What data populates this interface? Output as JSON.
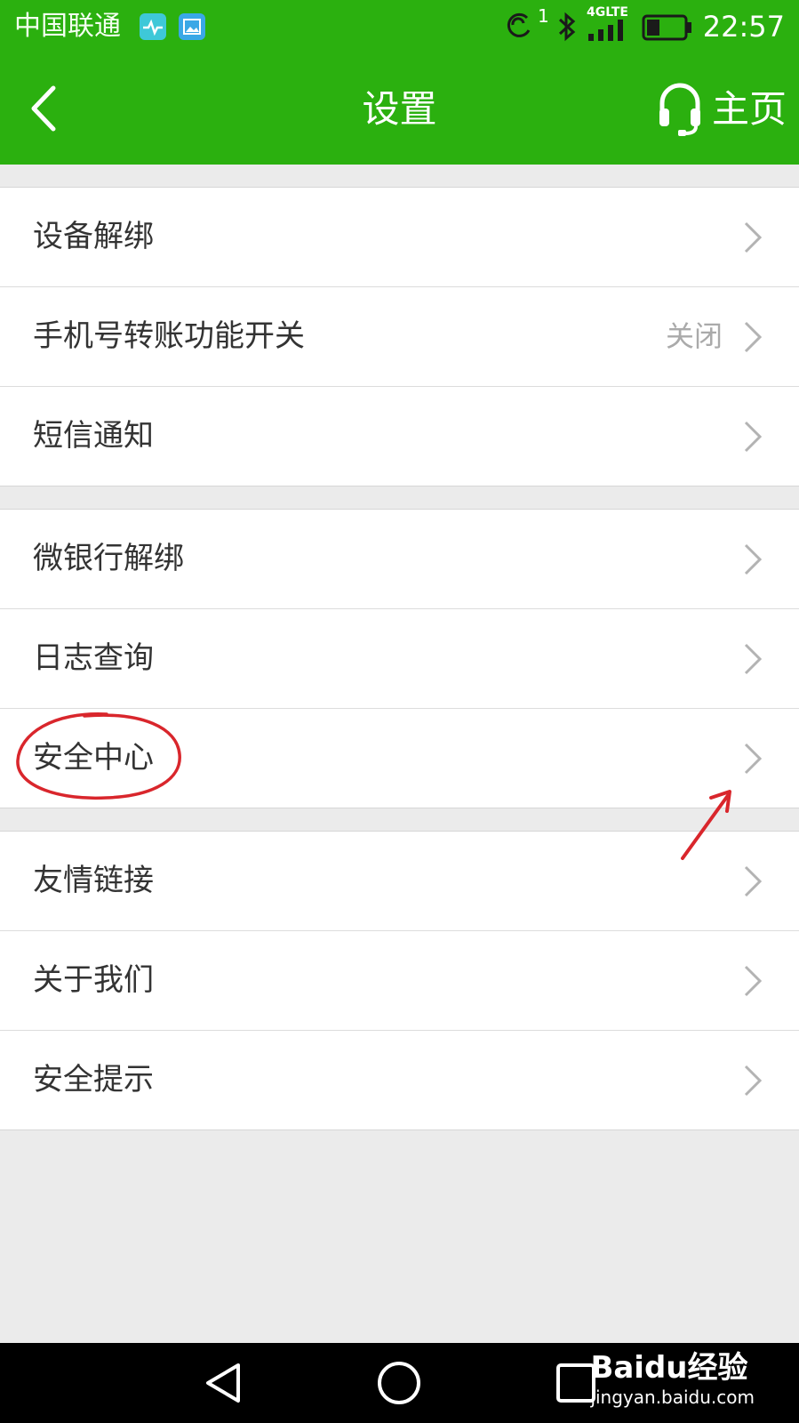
{
  "status_bar": {
    "carrier": "中国联通",
    "network": "4GLTE",
    "sim_badge": "1",
    "time": "22:57",
    "battery_level": 0.35
  },
  "header": {
    "title": "设置",
    "home_label": "主页"
  },
  "groups": [
    {
      "items": [
        {
          "label": "设备解绑",
          "value": ""
        },
        {
          "label": "手机号转账功能开关",
          "value": "关闭"
        },
        {
          "label": "短信通知",
          "value": ""
        }
      ]
    },
    {
      "items": [
        {
          "label": "微银行解绑",
          "value": ""
        },
        {
          "label": "日志查询",
          "value": ""
        },
        {
          "label": "安全中心",
          "value": ""
        }
      ]
    },
    {
      "items": [
        {
          "label": "友情链接",
          "value": ""
        },
        {
          "label": "关于我们",
          "value": ""
        },
        {
          "label": "安全提示",
          "value": ""
        }
      ]
    }
  ],
  "watermark": {
    "brand": "Baidu经验",
    "url": "jingyan.baidu.com"
  },
  "colors": {
    "header_green": "#2bb00f",
    "annotation_red": "#d9262c"
  }
}
